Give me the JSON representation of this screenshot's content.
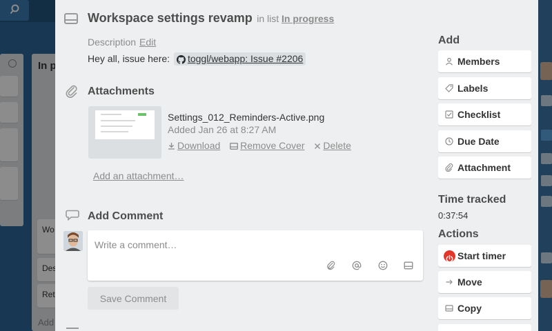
{
  "card": {
    "title": "Workspace settings revamp",
    "in_list_prefix": "in list",
    "list_name": "In progress"
  },
  "description": {
    "label": "Description",
    "edit_label": "Edit",
    "text_prefix": "Hey all, issue here:",
    "link_text": "toggl/webapp: Issue #2206"
  },
  "attachments": {
    "title": "Attachments",
    "file_name": "Settings_012_Reminders-Active.png",
    "added": "Added Jan 26 at 8:27 AM",
    "download_label": "Download",
    "remove_cover_label": "Remove Cover",
    "delete_label": "Delete",
    "add_label": "Add an attachment…"
  },
  "comment": {
    "title": "Add Comment",
    "placeholder": "Write a comment…",
    "save_label": "Save Comment",
    "tool_icons": [
      "paperclip-icon",
      "at-mention-icon",
      "emoji-icon",
      "card-icon"
    ]
  },
  "sidebar": {
    "add_title": "Add",
    "add_buttons": [
      {
        "label": "Members",
        "icon": "person-icon"
      },
      {
        "label": "Labels",
        "icon": "tag-icon"
      },
      {
        "label": "Checklist",
        "icon": "checkbox-icon"
      },
      {
        "label": "Due Date",
        "icon": "clock-icon"
      },
      {
        "label": "Attachment",
        "icon": "paperclip-icon"
      }
    ],
    "time_tracked_title": "Time tracked",
    "time_tracked_value": "0:37:54",
    "actions_title": "Actions",
    "action_buttons": [
      {
        "label": "Start timer",
        "icon": "power-icon"
      },
      {
        "label": "Move",
        "icon": "arrow-right-icon"
      },
      {
        "label": "Copy",
        "icon": "card-icon"
      }
    ]
  },
  "background": {
    "list_title": "In p",
    "card_labels": [
      "Wo",
      "Des",
      "Ret"
    ],
    "add_label": "Add"
  },
  "colors": {
    "board": "#2d6597",
    "modal": "#edeff0",
    "timer": "#e4352b"
  }
}
